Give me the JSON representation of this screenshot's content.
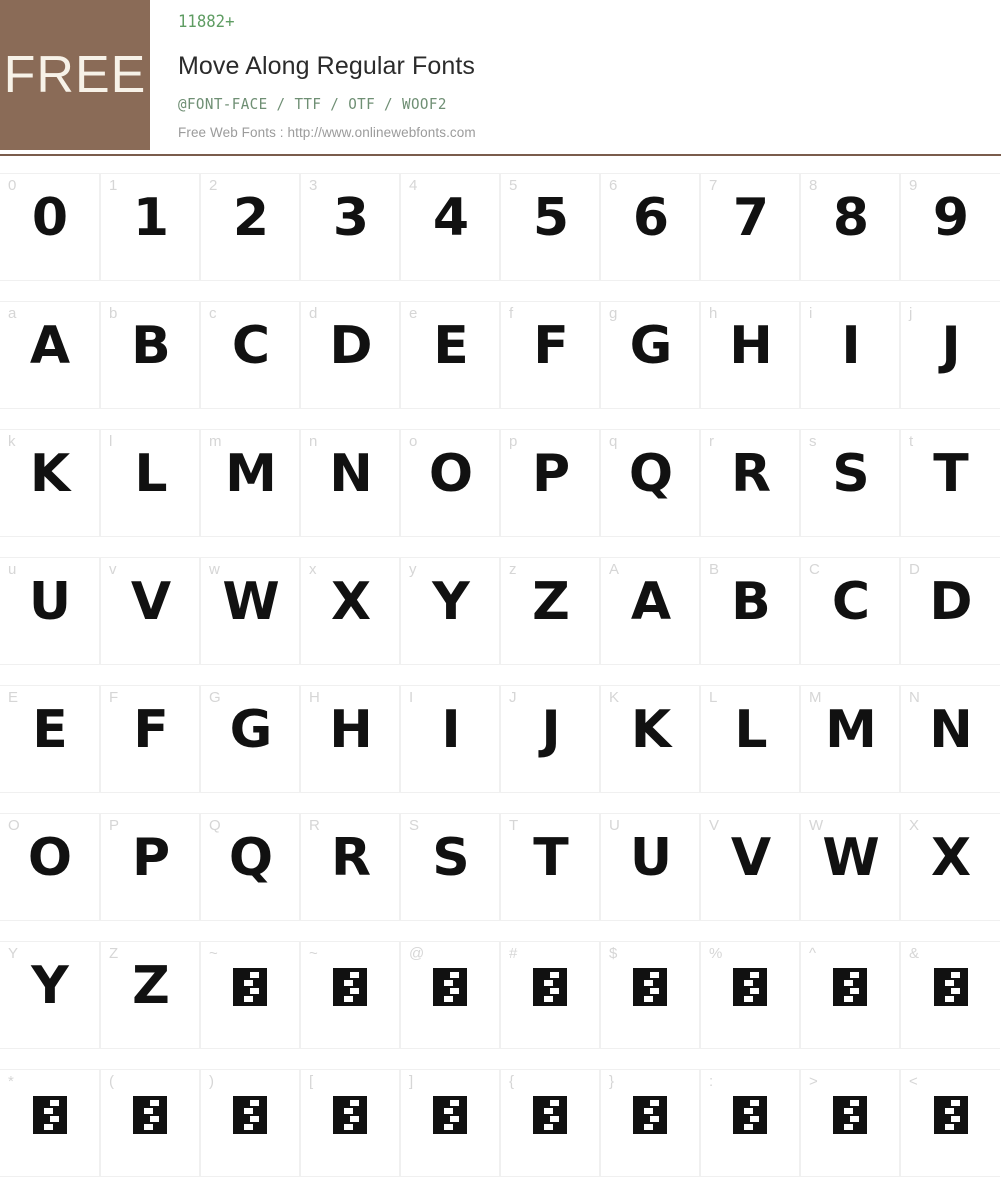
{
  "header": {
    "badge_label": "FREE",
    "font_count": "11882+",
    "title": "Move Along Regular Fonts",
    "formats": "@FONT-FACE / TTF / OTF / WOOF2",
    "site": "Free Web Fonts : http://www.onlinewebfonts.com",
    "badge_color": "#8a6b57",
    "badge_text_color": "#f7f2e8",
    "count_color": "#5e9c62",
    "formats_color": "#6f8f74",
    "site_color": "#9b9b9b",
    "divider_color": "#7a5c4c"
  },
  "grid": {
    "columns": 10,
    "label_color": "#d6d6d6",
    "glyph_color": "#111111",
    "cell_border_color": "#f0f0f0",
    "rows": [
      {
        "cells": [
          {
            "label": "0",
            "glyph": "0",
            "missing": false
          },
          {
            "label": "1",
            "glyph": "1",
            "missing": false
          },
          {
            "label": "2",
            "glyph": "2",
            "missing": false
          },
          {
            "label": "3",
            "glyph": "3",
            "missing": false
          },
          {
            "label": "4",
            "glyph": "4",
            "missing": false
          },
          {
            "label": "5",
            "glyph": "5",
            "missing": false
          },
          {
            "label": "6",
            "glyph": "6",
            "missing": false
          },
          {
            "label": "7",
            "glyph": "7",
            "missing": false
          },
          {
            "label": "8",
            "glyph": "8",
            "missing": false
          },
          {
            "label": "9",
            "glyph": "9",
            "missing": false
          }
        ]
      },
      {
        "cells": [
          {
            "label": "a",
            "glyph": "A",
            "missing": false
          },
          {
            "label": "b",
            "glyph": "B",
            "missing": false
          },
          {
            "label": "c",
            "glyph": "C",
            "missing": false
          },
          {
            "label": "d",
            "glyph": "D",
            "missing": false
          },
          {
            "label": "e",
            "glyph": "E",
            "missing": false
          },
          {
            "label": "f",
            "glyph": "F",
            "missing": false
          },
          {
            "label": "g",
            "glyph": "G",
            "missing": false
          },
          {
            "label": "h",
            "glyph": "H",
            "missing": false
          },
          {
            "label": "i",
            "glyph": "I",
            "missing": false
          },
          {
            "label": "j",
            "glyph": "J",
            "missing": false
          }
        ]
      },
      {
        "cells": [
          {
            "label": "k",
            "glyph": "K",
            "missing": false
          },
          {
            "label": "l",
            "glyph": "L",
            "missing": false
          },
          {
            "label": "m",
            "glyph": "M",
            "missing": false
          },
          {
            "label": "n",
            "glyph": "N",
            "missing": false
          },
          {
            "label": "o",
            "glyph": "O",
            "missing": false
          },
          {
            "label": "p",
            "glyph": "P",
            "missing": false
          },
          {
            "label": "q",
            "glyph": "Q",
            "missing": false
          },
          {
            "label": "r",
            "glyph": "R",
            "missing": false
          },
          {
            "label": "s",
            "glyph": "S",
            "missing": false
          },
          {
            "label": "t",
            "glyph": "T",
            "missing": false
          }
        ]
      },
      {
        "cells": [
          {
            "label": "u",
            "glyph": "U",
            "missing": false
          },
          {
            "label": "v",
            "glyph": "V",
            "missing": false
          },
          {
            "label": "w",
            "glyph": "W",
            "missing": false
          },
          {
            "label": "x",
            "glyph": "X",
            "missing": false
          },
          {
            "label": "y",
            "glyph": "Y",
            "missing": false
          },
          {
            "label": "z",
            "glyph": "Z",
            "missing": false
          },
          {
            "label": "A",
            "glyph": "A",
            "missing": false
          },
          {
            "label": "B",
            "glyph": "B",
            "missing": false
          },
          {
            "label": "C",
            "glyph": "C",
            "missing": false
          },
          {
            "label": "D",
            "glyph": "D",
            "missing": false
          }
        ]
      },
      {
        "cells": [
          {
            "label": "E",
            "glyph": "E",
            "missing": false
          },
          {
            "label": "F",
            "glyph": "F",
            "missing": false
          },
          {
            "label": "G",
            "glyph": "G",
            "missing": false
          },
          {
            "label": "H",
            "glyph": "H",
            "missing": false
          },
          {
            "label": "I",
            "glyph": "I",
            "missing": false
          },
          {
            "label": "J",
            "glyph": "J",
            "missing": false
          },
          {
            "label": "K",
            "glyph": "K",
            "missing": false
          },
          {
            "label": "L",
            "glyph": "L",
            "missing": false
          },
          {
            "label": "M",
            "glyph": "M",
            "missing": false
          },
          {
            "label": "N",
            "glyph": "N",
            "missing": false
          }
        ]
      },
      {
        "cells": [
          {
            "label": "O",
            "glyph": "O",
            "missing": false
          },
          {
            "label": "P",
            "glyph": "P",
            "missing": false
          },
          {
            "label": "Q",
            "glyph": "Q",
            "missing": false
          },
          {
            "label": "R",
            "glyph": "R",
            "missing": false
          },
          {
            "label": "S",
            "glyph": "S",
            "missing": false
          },
          {
            "label": "T",
            "glyph": "T",
            "missing": false
          },
          {
            "label": "U",
            "glyph": "U",
            "missing": false
          },
          {
            "label": "V",
            "glyph": "V",
            "missing": false
          },
          {
            "label": "W",
            "glyph": "W",
            "missing": false
          },
          {
            "label": "X",
            "glyph": "X",
            "missing": false
          }
        ]
      },
      {
        "cells": [
          {
            "label": "Y",
            "glyph": "Y",
            "missing": false
          },
          {
            "label": "Z",
            "glyph": "Z",
            "missing": false
          },
          {
            "label": "~",
            "glyph": "",
            "missing": true
          },
          {
            "label": "~",
            "glyph": "",
            "missing": true
          },
          {
            "label": "@",
            "glyph": "",
            "missing": true
          },
          {
            "label": "#",
            "glyph": "",
            "missing": true
          },
          {
            "label": "$",
            "glyph": "",
            "missing": true
          },
          {
            "label": "%",
            "glyph": "",
            "missing": true
          },
          {
            "label": "^",
            "glyph": "",
            "missing": true
          },
          {
            "label": "&",
            "glyph": "",
            "missing": true
          }
        ]
      },
      {
        "cells": [
          {
            "label": "*",
            "glyph": "",
            "missing": true
          },
          {
            "label": "(",
            "glyph": "",
            "missing": true
          },
          {
            "label": ")",
            "glyph": "",
            "missing": true
          },
          {
            "label": "[",
            "glyph": "",
            "missing": true
          },
          {
            "label": "]",
            "glyph": "",
            "missing": true
          },
          {
            "label": "{",
            "glyph": "",
            "missing": true
          },
          {
            "label": "}",
            "glyph": "",
            "missing": true
          },
          {
            "label": ":",
            "glyph": "",
            "missing": true
          },
          {
            "label": ">",
            "glyph": "",
            "missing": true
          },
          {
            "label": "<",
            "glyph": "",
            "missing": true
          }
        ]
      }
    ]
  }
}
